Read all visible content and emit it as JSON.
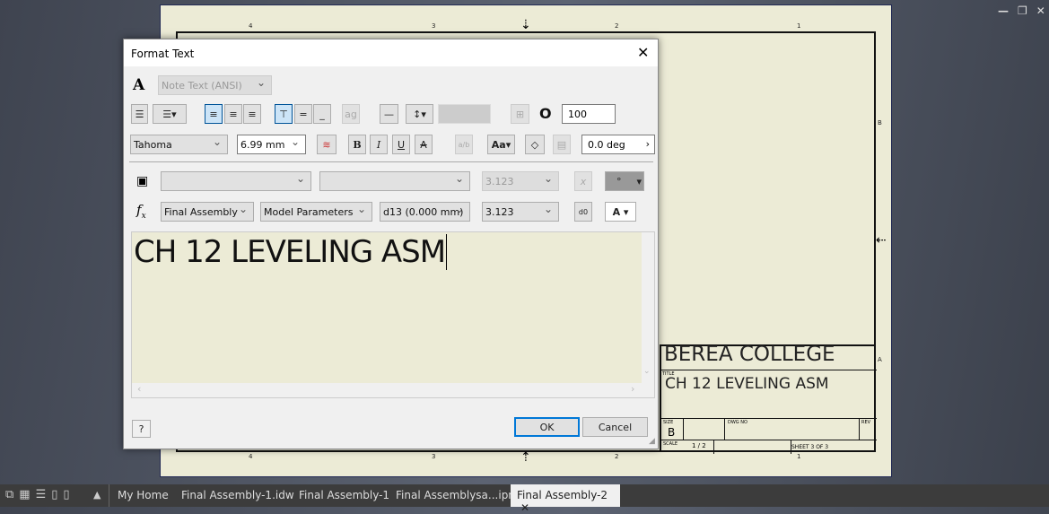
{
  "window_controls": {
    "minimize": "minimize-icon",
    "restore": "restore-icon",
    "close": "close-icon"
  },
  "drawing": {
    "zones_top": [
      "4",
      "3",
      "2",
      "1"
    ],
    "zones_bottom": [
      "4",
      "3",
      "2",
      "1"
    ],
    "zones_right": [
      "B",
      "A"
    ],
    "title_block": {
      "company": "BEREA COLLEGE",
      "title_label": "TITLE",
      "title": "CH 12 LEVELING ASM",
      "size_label": "SIZE",
      "size": "B",
      "dwg_no_label": "DWG NO",
      "rev_label": "REV",
      "scale_label": "SCALE",
      "scale": "1 / 2",
      "sheet": "SHEET 3  OF 3"
    },
    "sheet_color": "#ecebd6"
  },
  "dialog": {
    "title": "Format Text",
    "style": "Note Text (ANSI)",
    "font": "Tahoma",
    "size": "6.99 mm",
    "width_scale": "100",
    "rotation": "0.0 deg",
    "row_params": {
      "component": "Final Assembly",
      "source": "Model Parameters",
      "parameter": "d13 (0.000 mm)",
      "precision": "3.123",
      "precision_disabled": "3.123"
    },
    "text": "CH 12 LEVELING ASM",
    "ok": "OK",
    "cancel": "Cancel",
    "help": "?"
  },
  "taskbar": {
    "tabs": [
      "My Home",
      "Final Assembly-1.idw",
      "Final Assembly-1",
      "Final Assemblysa...ipn",
      "Final Assembly-2"
    ],
    "active": "Final Assembly-2"
  }
}
